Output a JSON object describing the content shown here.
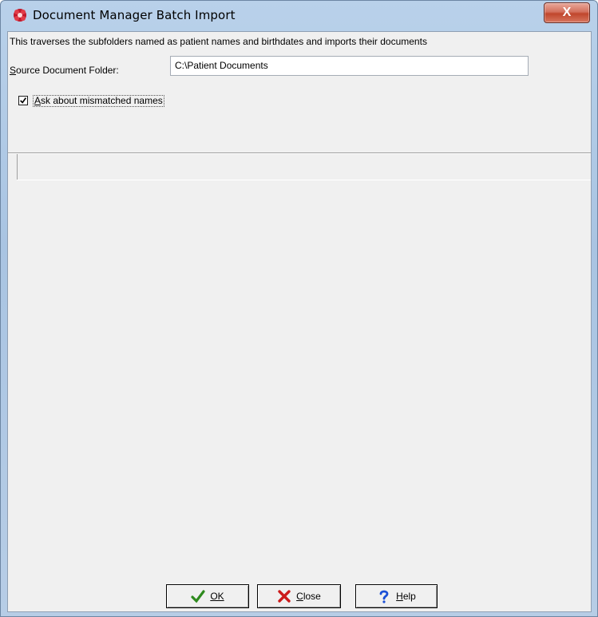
{
  "window": {
    "title": "Document Manager Batch Import",
    "close_label": "X"
  },
  "form": {
    "description": "This traverses the subfolders named as patient names and birthdates and imports their documents",
    "source_label_mnemonic": "S",
    "source_label_rest": "ource Document Folder:",
    "source_value": "C:\\Patient Documents",
    "ask_checkbox": {
      "checked": true,
      "label_mnemonic": "A",
      "label_rest": "sk about mismatched names"
    }
  },
  "buttons": {
    "ok": {
      "mnemonic": "OK",
      "rest": "",
      "icon": "green-check-icon"
    },
    "close": {
      "mnemonic": "C",
      "rest": "lose",
      "icon": "red-x-icon"
    },
    "help": {
      "mnemonic": "H",
      "rest": "elp",
      "icon": "blue-question-icon"
    }
  },
  "colors": {
    "client_bg": "#f0f0f0",
    "titlebar": "#b9d1ea",
    "close_button": "#c0462c"
  }
}
